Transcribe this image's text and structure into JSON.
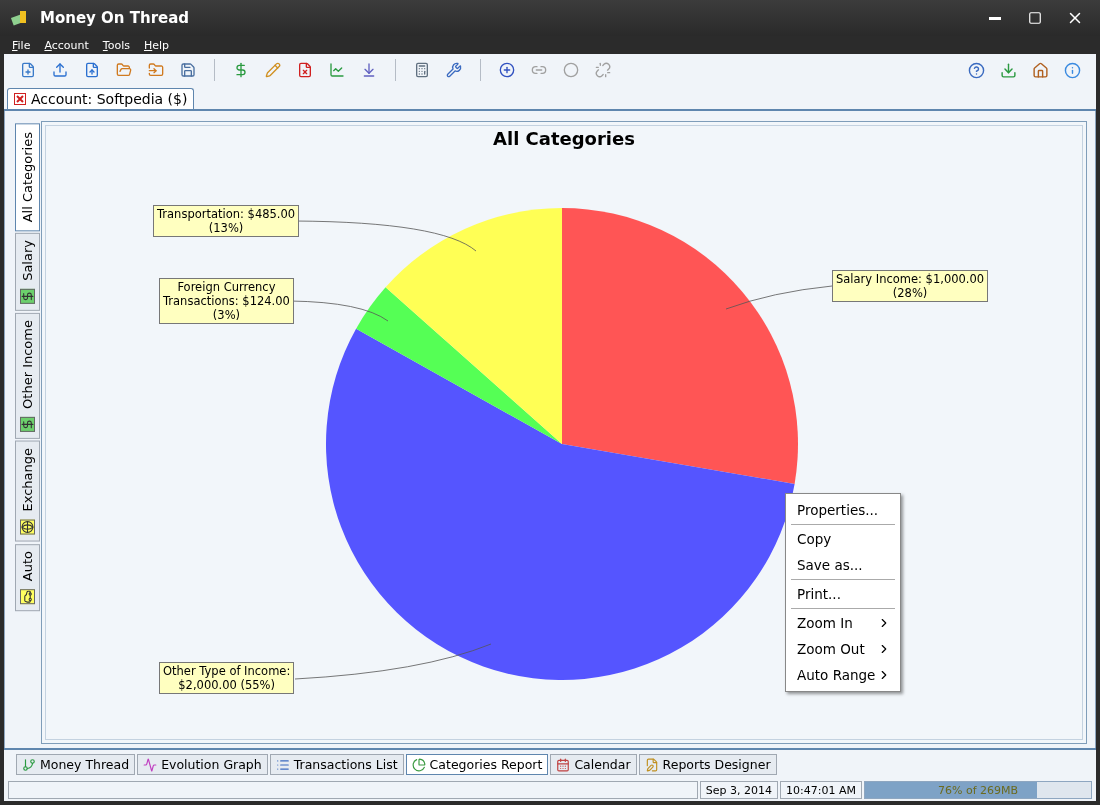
{
  "window": {
    "title": "Money On Thread"
  },
  "menu": [
    "File",
    "Account",
    "Tools",
    "Help"
  ],
  "account_tab": {
    "label": "Account: Softpedia ($)"
  },
  "side_tabs": [
    {
      "label": "All Categories",
      "selected": true
    },
    {
      "label": "Salary",
      "selected": false
    },
    {
      "label": "Other Income",
      "selected": false
    },
    {
      "label": "Exchange",
      "selected": false
    },
    {
      "label": "Auto",
      "selected": false
    }
  ],
  "chart": {
    "chart_data": {
      "type": "pie",
      "title": "All Categories",
      "values": [
        1000,
        2000,
        124,
        485
      ],
      "colors": [
        "#ff5555",
        "#5555ff",
        "#55ff55",
        "#ffff55"
      ],
      "value_labels": [
        "Salary Income: $1,000.00\n(28%)",
        "Other Type of Income:\n$2,000.00 (55%)",
        "Foreign Currency\nTransactions: $124.00\n(3%)",
        "Transportation: $485.00\n(13%)"
      ]
    }
  },
  "context_menu": [
    {
      "kind": "item",
      "label": "Properties...",
      "submenu": false
    },
    {
      "kind": "separator"
    },
    {
      "kind": "item",
      "label": "Copy",
      "submenu": false
    },
    {
      "kind": "item",
      "label": "Save as...",
      "submenu": false
    },
    {
      "kind": "separator"
    },
    {
      "kind": "item",
      "label": "Print...",
      "submenu": false
    },
    {
      "kind": "separator"
    },
    {
      "kind": "item",
      "label": "Zoom In",
      "submenu": true
    },
    {
      "kind": "item",
      "label": "Zoom Out",
      "submenu": true
    },
    {
      "kind": "item",
      "label": "Auto Range",
      "submenu": true
    }
  ],
  "bottom_tabs": [
    {
      "label": "Money Thread",
      "selected": false
    },
    {
      "label": "Evolution Graph",
      "selected": false
    },
    {
      "label": "Transactions List",
      "selected": false
    },
    {
      "label": "Categories Report",
      "selected": true
    },
    {
      "label": "Calendar",
      "selected": false
    },
    {
      "label": "Reports Designer",
      "selected": false
    }
  ],
  "status_bar": {
    "date": "Sep 3, 2014",
    "time": "10:47:01 AM",
    "memory": {
      "label": "76% of 269MB",
      "level": 0.76
    }
  }
}
